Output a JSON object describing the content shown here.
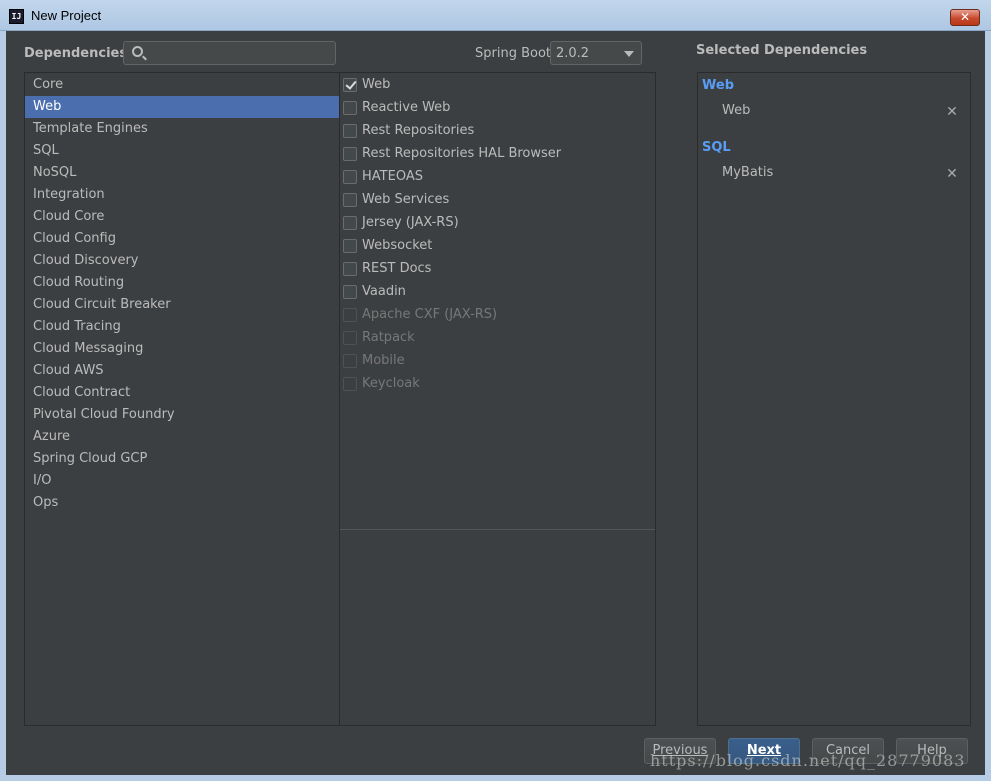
{
  "window": {
    "title": "New Project",
    "icon_text": "IJ",
    "close_glyph": "✕"
  },
  "header": {
    "dependencies_label": "Dependencies",
    "search_value": "",
    "spring_boot_label": "Spring Boot",
    "spring_boot_version": "2.0.2",
    "selected_label": "Selected Dependencies"
  },
  "categories": [
    "Core",
    "Web",
    "Template Engines",
    "SQL",
    "NoSQL",
    "Integration",
    "Cloud Core",
    "Cloud Config",
    "Cloud Discovery",
    "Cloud Routing",
    "Cloud Circuit Breaker",
    "Cloud Tracing",
    "Cloud Messaging",
    "Cloud AWS",
    "Cloud Contract",
    "Pivotal Cloud Foundry",
    "Azure",
    "Spring Cloud GCP",
    "I/O",
    "Ops"
  ],
  "selected_category": "Web",
  "dependencies": [
    {
      "label": "Web",
      "checked": true,
      "enabled": true
    },
    {
      "label": "Reactive Web",
      "checked": false,
      "enabled": true
    },
    {
      "label": "Rest Repositories",
      "checked": false,
      "enabled": true
    },
    {
      "label": "Rest Repositories HAL Browser",
      "checked": false,
      "enabled": true
    },
    {
      "label": "HATEOAS",
      "checked": false,
      "enabled": true
    },
    {
      "label": "Web Services",
      "checked": false,
      "enabled": true
    },
    {
      "label": "Jersey (JAX-RS)",
      "checked": false,
      "enabled": true
    },
    {
      "label": "Websocket",
      "checked": false,
      "enabled": true
    },
    {
      "label": "REST Docs",
      "checked": false,
      "enabled": true
    },
    {
      "label": "Vaadin",
      "checked": false,
      "enabled": true
    },
    {
      "label": "Apache CXF (JAX-RS)",
      "checked": false,
      "enabled": false
    },
    {
      "label": "Ratpack",
      "checked": false,
      "enabled": false
    },
    {
      "label": "Mobile",
      "checked": false,
      "enabled": false
    },
    {
      "label": "Keycloak",
      "checked": false,
      "enabled": false
    }
  ],
  "selected_dependencies": [
    {
      "group": "Web",
      "items": [
        "Web"
      ]
    },
    {
      "group": "SQL",
      "items": [
        "MyBatis"
      ]
    }
  ],
  "remove_glyph": "✕",
  "buttons": {
    "previous": "Previous",
    "next": "Next",
    "cancel": "Cancel",
    "help": "Help"
  },
  "watermark": "https://blog.csdn.net/qq_28779083",
  "colors": {
    "background": "#3c3f41",
    "selection": "#4b6eaf",
    "group_header": "#589df6",
    "primary_button": "#365880"
  }
}
